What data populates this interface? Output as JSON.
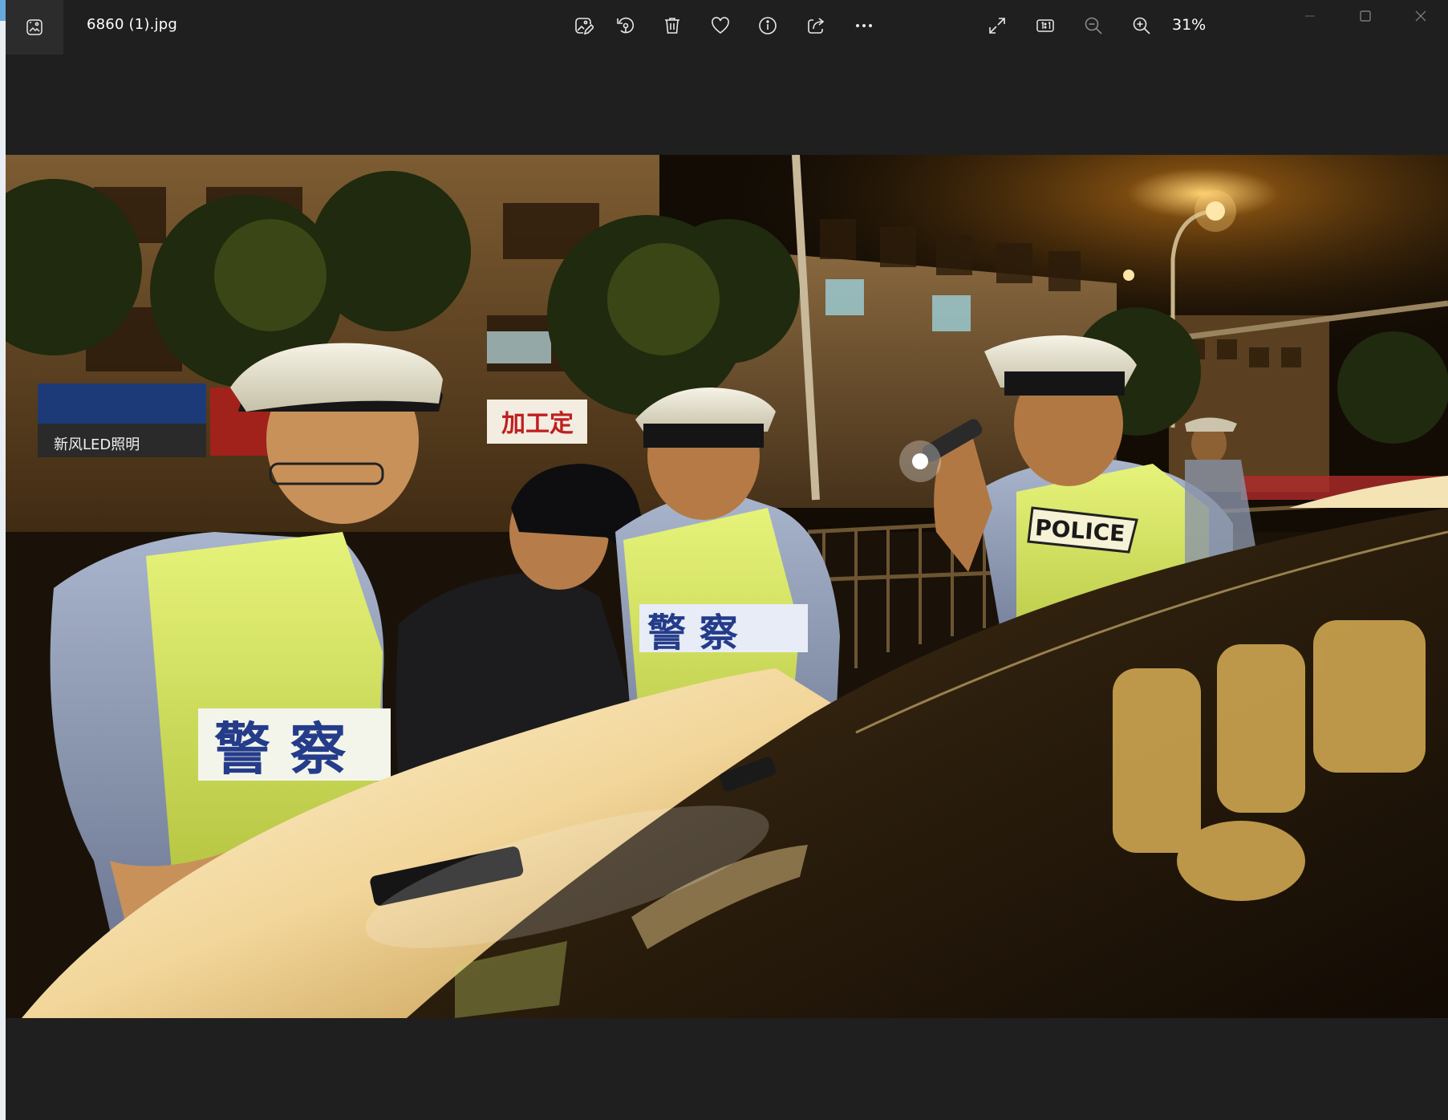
{
  "window": {
    "filename": "6860 (1).jpg",
    "zoom_level": "31%"
  },
  "toolbar": {
    "buttons": [
      {
        "name": "edit-image-button",
        "icon": "edit-image-icon"
      },
      {
        "name": "rotate-button",
        "icon": "rotate-icon"
      },
      {
        "name": "delete-button",
        "icon": "trash-icon"
      },
      {
        "name": "favorite-button",
        "icon": "heart-icon"
      },
      {
        "name": "file-info-button",
        "icon": "info-icon"
      },
      {
        "name": "share-button",
        "icon": "share-icon"
      },
      {
        "name": "more-options-button",
        "icon": "more-icon"
      },
      {
        "name": "fullscreen-button",
        "icon": "expand-icon"
      },
      {
        "name": "actual-size-button",
        "icon": "actual-size-icon",
        "label": "1:1"
      },
      {
        "name": "zoom-out-button",
        "icon": "zoom-out-icon"
      },
      {
        "name": "zoom-in-button",
        "icon": "zoom-in-icon"
      }
    ]
  },
  "window_controls": [
    "minimize",
    "maximize",
    "close"
  ],
  "photo": {
    "vest_text_left": "警 察",
    "vest_text_center": "警 察",
    "vest_text_right": "POLICE",
    "shop_sign": "加工定",
    "shop_sign_left": "新风LED照明"
  },
  "colors": {
    "window_bg": "#1f1f1f",
    "icon_color": "#e8e8e8",
    "disabled_icon": "#8a8a8a"
  }
}
